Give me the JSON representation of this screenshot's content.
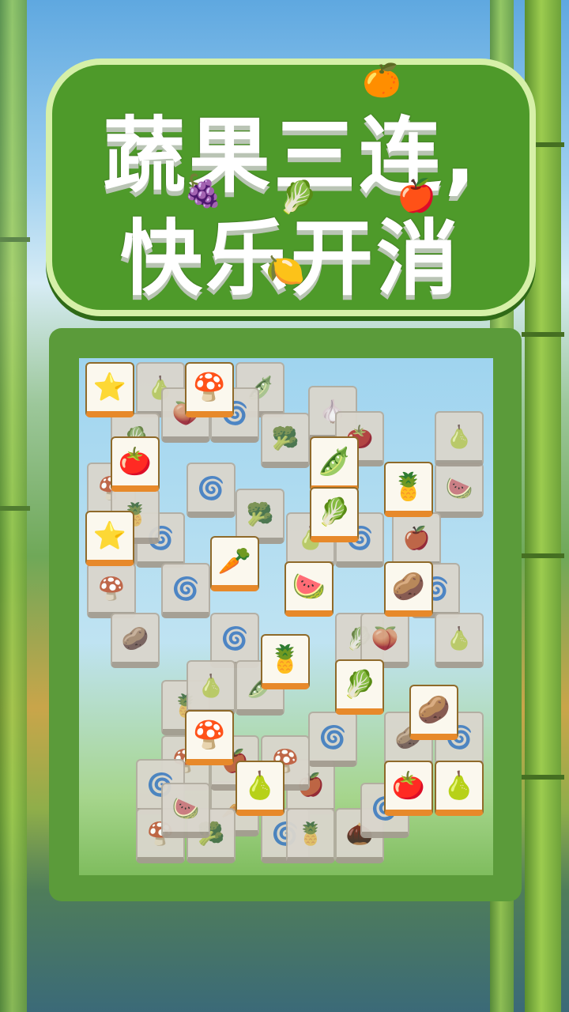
{
  "title": {
    "line1": "蔬果三连,",
    "line2": "快乐开消"
  },
  "title_decorations": [
    {
      "name": "orange-icon",
      "glyph": "🍊"
    },
    {
      "name": "grapes-icon",
      "glyph": "🍇"
    },
    {
      "name": "lettuce-icon",
      "glyph": "🥬"
    },
    {
      "name": "apple-icon",
      "glyph": "🍎"
    },
    {
      "name": "lemon-icon",
      "glyph": "🍋"
    }
  ],
  "tiles_low": [
    {
      "icon": "pear-icon",
      "glyph": "🍐"
    },
    {
      "icon": "okra-icon",
      "glyph": "🫛"
    },
    {
      "icon": "cabbage-icon",
      "glyph": "🥬"
    },
    {
      "icon": "swirl-icon",
      "glyph": "🌀"
    },
    {
      "icon": "peach-icon",
      "glyph": "🍑"
    },
    {
      "icon": "mushroom-icon",
      "glyph": "🍄"
    },
    {
      "icon": "cauliflower-icon",
      "glyph": "🥦"
    },
    {
      "icon": "swirl-icon",
      "glyph": "🌀"
    },
    {
      "icon": "chestnut-icon",
      "glyph": "🌰"
    },
    {
      "icon": "swirl-icon",
      "glyph": "🌀"
    },
    {
      "icon": "watermelon-icon",
      "glyph": "🍉"
    },
    {
      "icon": "pineapple-icon",
      "glyph": "🍍"
    },
    {
      "icon": "swirl-icon",
      "glyph": "🌀"
    },
    {
      "icon": "pear-icon",
      "glyph": "🍐"
    },
    {
      "icon": "apple-icon",
      "glyph": "🍎"
    },
    {
      "icon": "mushroom-icon",
      "glyph": "🍄"
    },
    {
      "icon": "swirl-icon",
      "glyph": "🌀"
    },
    {
      "icon": "walnut-icon",
      "glyph": "🥔"
    },
    {
      "icon": "cauliflower-icon",
      "glyph": "🥦"
    },
    {
      "icon": "swirl-icon",
      "glyph": "🌀"
    },
    {
      "icon": "garlic-icon",
      "glyph": "🧄"
    },
    {
      "icon": "persimmon-icon",
      "glyph": "🍅"
    },
    {
      "icon": "pear-icon",
      "glyph": "🍐"
    },
    {
      "icon": "swirl-icon",
      "glyph": "🌀"
    },
    {
      "icon": "pineapple-icon",
      "glyph": "🍍"
    },
    {
      "icon": "mushroom-icon",
      "glyph": "🍄"
    },
    {
      "icon": "walnut-icon",
      "glyph": "🥔"
    },
    {
      "icon": "swirl-icon",
      "glyph": "🌀"
    },
    {
      "icon": "radish-icon",
      "glyph": "🥕"
    },
    {
      "icon": "apple-icon",
      "glyph": "🍎"
    }
  ],
  "tiles_top": [
    {
      "icon": "starfruit-icon",
      "glyph": "⭐"
    },
    {
      "icon": "mushroom-icon",
      "glyph": "🍄"
    },
    {
      "icon": "persimmon-icon",
      "glyph": "🍅"
    },
    {
      "icon": "okra-icon",
      "glyph": "🫛"
    },
    {
      "icon": "pineapple-icon",
      "glyph": "🍍"
    },
    {
      "icon": "starfruit-icon",
      "glyph": "⭐"
    },
    {
      "icon": "cabbage-icon",
      "glyph": "🥬"
    },
    {
      "icon": "radish-icon",
      "glyph": "🥕"
    },
    {
      "icon": "watermelon-icon",
      "glyph": "🍉"
    },
    {
      "icon": "walnut-icon",
      "glyph": "🥔"
    },
    {
      "icon": "pineapple-icon",
      "glyph": "🍍"
    },
    {
      "icon": "cabbage-icon",
      "glyph": "🥬"
    },
    {
      "icon": "walnut-icon",
      "glyph": "🥔"
    },
    {
      "icon": "mushroom-icon",
      "glyph": "🍄"
    },
    {
      "icon": "pear-icon",
      "glyph": "🍐"
    },
    {
      "icon": "persimmon-icon",
      "glyph": "🍅"
    },
    {
      "icon": "pear-icon",
      "glyph": "🍐"
    }
  ]
}
